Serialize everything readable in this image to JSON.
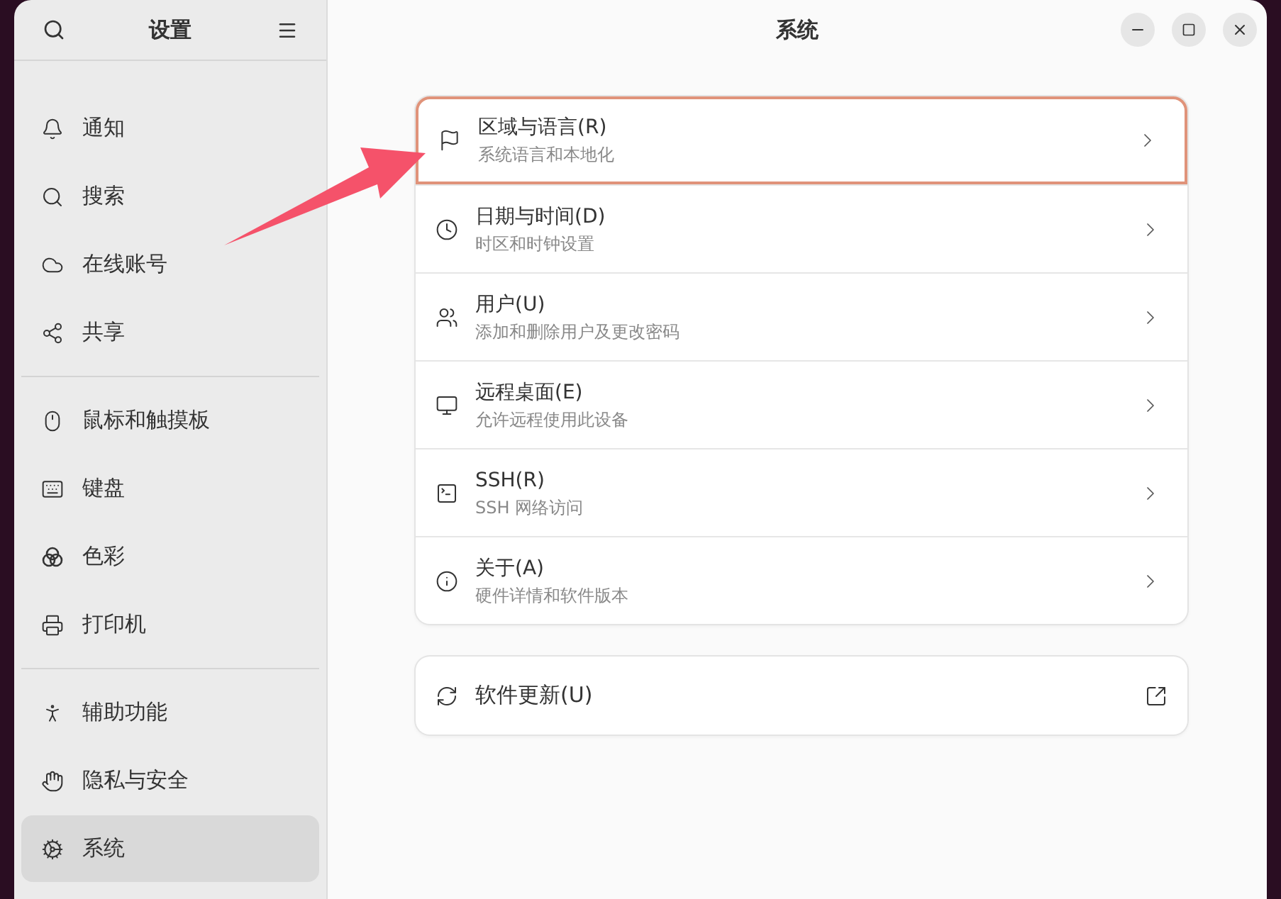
{
  "sidebar": {
    "title": "设置",
    "groups": [
      {
        "items": [
          {
            "label": "通知",
            "selected": false
          },
          {
            "label": "搜索",
            "selected": false
          },
          {
            "label": "在线账号",
            "selected": false
          },
          {
            "label": "共享",
            "selected": false
          }
        ]
      },
      {
        "items": [
          {
            "label": "鼠标和触摸板",
            "selected": false
          },
          {
            "label": "键盘",
            "selected": false
          },
          {
            "label": "色彩",
            "selected": false
          },
          {
            "label": "打印机",
            "selected": false
          }
        ]
      },
      {
        "items": [
          {
            "label": "辅助功能",
            "selected": false
          },
          {
            "label": "隐私与安全",
            "selected": false
          },
          {
            "label": "系统",
            "selected": true
          }
        ]
      }
    ]
  },
  "window": {
    "title": "系统"
  },
  "settings_list": [
    {
      "title": "区域与语言(R)",
      "subtitle": "系统语言和本地化",
      "highlighted": true
    },
    {
      "title": "日期与时间(D)",
      "subtitle": "时区和时钟设置",
      "highlighted": false
    },
    {
      "title": "用户(U)",
      "subtitle": "添加和删除用户及更改密码",
      "highlighted": false
    },
    {
      "title": "远程桌面(E)",
      "subtitle": "允许远程使用此设备",
      "highlighted": false
    },
    {
      "title": "SSH(R)",
      "subtitle": "SSH 网络访问",
      "highlighted": false
    },
    {
      "title": "关于(A)",
      "subtitle": "硬件详情和软件版本",
      "highlighted": false
    }
  ],
  "update_row": {
    "title": "软件更新(U)"
  }
}
